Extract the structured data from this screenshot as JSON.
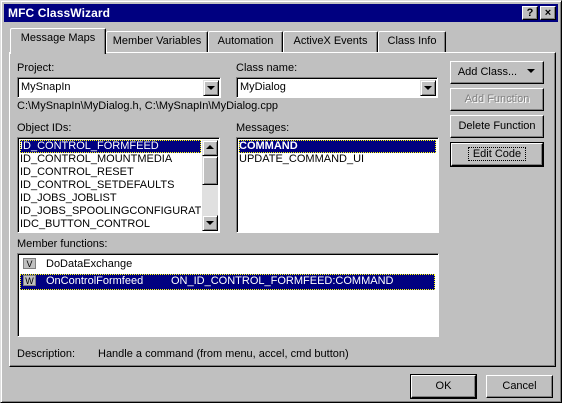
{
  "window": {
    "title": "MFC ClassWizard",
    "help_glyph": "?",
    "close_glyph": "×"
  },
  "tabs": [
    {
      "label": "Message Maps",
      "active": true
    },
    {
      "label": "Member Variables"
    },
    {
      "label": "Automation"
    },
    {
      "label": "ActiveX Events"
    },
    {
      "label": "Class Info"
    }
  ],
  "project": {
    "label": "Project:",
    "value": "MySnapIn"
  },
  "class_name": {
    "label": "Class name:",
    "value": "MyDialog"
  },
  "files_path": "C:\\MySnapIn\\MyDialog.h, C:\\MySnapIn\\MyDialog.cpp",
  "object_ids": {
    "label": "Object IDs:",
    "items": [
      "ID_CONTROL_FORMFEED",
      "ID_CONTROL_MOUNTMEDIA",
      "ID_CONTROL_RESET",
      "ID_CONTROL_SETDEFAULTS",
      "ID_JOBS_JOBLIST",
      "ID_JOBS_SPOOLINGCONFIGURATIO",
      "IDC_BUTTON_CONTROL"
    ],
    "selected_index": 0
  },
  "messages": {
    "label": "Messages:",
    "items": [
      "COMMAND",
      "UPDATE_COMMAND_UI"
    ],
    "selected_index": 0
  },
  "member_functions": {
    "label": "Member functions:",
    "items": [
      {
        "icon": "V",
        "name": "DoDataExchange",
        "handler": ""
      },
      {
        "icon": "W",
        "name": "OnControlFormfeed",
        "handler": "ON_ID_CONTROL_FORMFEED:COMMAND"
      }
    ],
    "selected_index": 1
  },
  "description": {
    "label": "Description:",
    "text": "Handle a command (from menu, accel, cmd button)"
  },
  "buttons": {
    "add_class": "Add Class...",
    "add_function": "Add Function",
    "delete_function": "Delete Function",
    "edit_code": "Edit Code",
    "ok": "OK",
    "cancel": "Cancel"
  },
  "colors": {
    "titlebar": "#000080",
    "face": "#c0c0c0",
    "selection": "#000080"
  }
}
